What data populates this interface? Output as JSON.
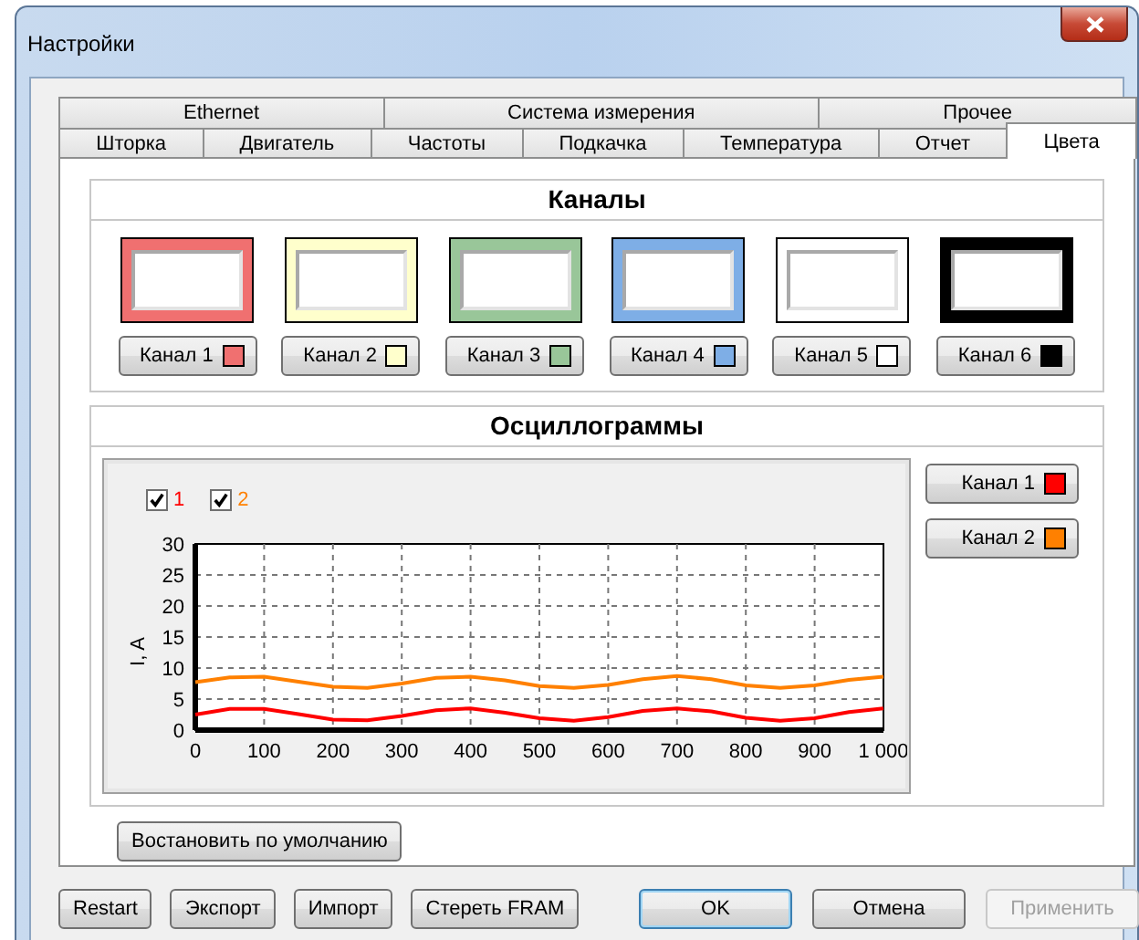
{
  "window": {
    "title": "Настройки"
  },
  "tab_rows": [
    [
      {
        "label": "Ethernet",
        "selected": false
      },
      {
        "label": "Система измерения",
        "selected": false
      },
      {
        "label": "Прочее",
        "selected": false
      }
    ],
    [
      {
        "label": "Шторка",
        "selected": false
      },
      {
        "label": "Двигатель",
        "selected": false
      },
      {
        "label": "Частоты",
        "selected": false
      },
      {
        "label": "Подкачка",
        "selected": false
      },
      {
        "label": "Температура",
        "selected": false
      },
      {
        "label": "Отчет",
        "selected": false
      },
      {
        "label": "Цвета",
        "selected": true
      }
    ]
  ],
  "channels": {
    "title": "Каналы",
    "items": [
      {
        "label": "Канал 1",
        "color": "#f07070"
      },
      {
        "label": "Канал 2",
        "color": "#ffffcc"
      },
      {
        "label": "Канал 3",
        "color": "#99c699"
      },
      {
        "label": "Канал 4",
        "color": "#7eaee6"
      },
      {
        "label": "Канал 5",
        "color": "#ffffff"
      },
      {
        "label": "Канал 6",
        "color": "#000000"
      }
    ]
  },
  "oscillograms": {
    "title": "Осциллограммы",
    "toggles": [
      {
        "checked": true
      },
      {
        "checked": true
      }
    ],
    "chart_data": {
      "type": "line",
      "ylabel": "I, A",
      "grid": true,
      "xlim": [
        0,
        1000
      ],
      "ylim": [
        0,
        30
      ],
      "xticks": [
        0,
        100,
        200,
        300,
        400,
        500,
        600,
        700,
        800,
        900,
        {
          "value": 1000,
          "label": "1 000"
        }
      ],
      "yticks": [
        0,
        5,
        10,
        15,
        20,
        25,
        30
      ],
      "x": [
        0,
        50,
        100,
        150,
        200,
        250,
        300,
        350,
        400,
        450,
        500,
        550,
        600,
        650,
        700,
        750,
        800,
        850,
        900,
        950,
        1000
      ],
      "series": [
        {
          "name": "1",
          "color": "#ff0000",
          "values": [
            2.5,
            3.4,
            3.4,
            2.6,
            1.7,
            1.6,
            2.3,
            3.2,
            3.5,
            2.8,
            1.9,
            1.5,
            2.1,
            3.1,
            3.5,
            3,
            2,
            1.5,
            1.9,
            2.9,
            3.5
          ]
        },
        {
          "name": "2",
          "color": "#ff8000",
          "values": [
            7.7,
            8.5,
            8.6,
            7.8,
            7,
            6.8,
            7.5,
            8.4,
            8.6,
            8,
            7.1,
            6.8,
            7.3,
            8.2,
            8.7,
            8.2,
            7.2,
            6.8,
            7.2,
            8.1,
            8.6
          ]
        }
      ]
    },
    "channel_buttons": [
      {
        "label": "Канал 1",
        "color": "#ff0000"
      },
      {
        "label": "Канал 2",
        "color": "#ff8000"
      }
    ]
  },
  "restore_button": "Востановить по умолчанию",
  "left_buttons": [
    "Restart",
    "Экспорт",
    "Импорт",
    "Стереть FRAM"
  ],
  "dialog_buttons": [
    {
      "label": "OK",
      "default": true,
      "disabled": false
    },
    {
      "label": "Отмена",
      "default": false,
      "disabled": false
    },
    {
      "label": "Применить",
      "default": false,
      "disabled": true
    }
  ]
}
